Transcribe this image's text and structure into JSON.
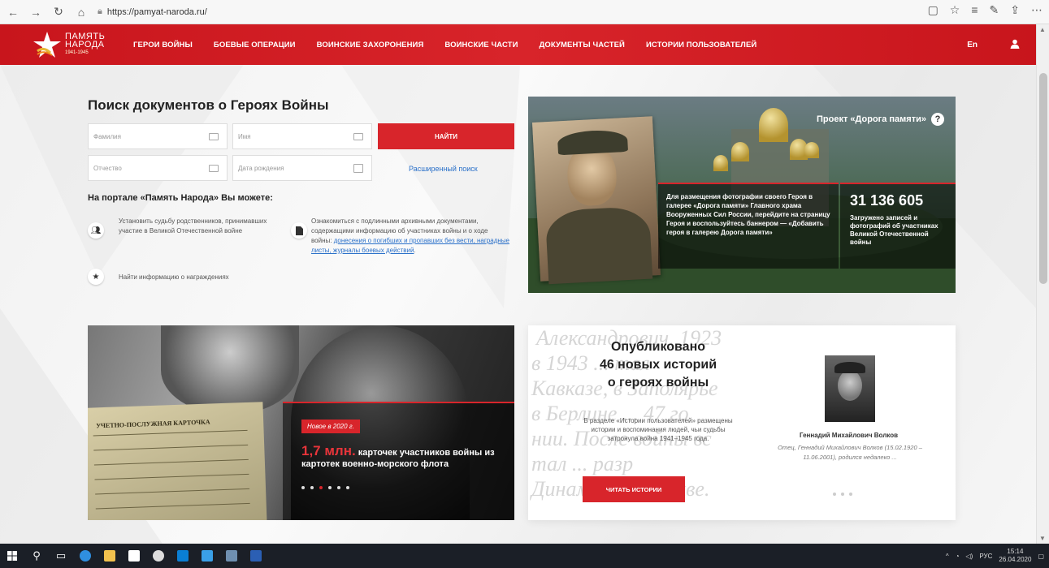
{
  "browser": {
    "url": "https://pamyat-naroda.ru/"
  },
  "header": {
    "logo_line1": "ПАМЯТЬ",
    "logo_line2": "НАРОДА",
    "logo_line3": "1941-1945",
    "menu": [
      "ГЕРОИ ВОЙНЫ",
      "БОЕВЫЕ ОПЕРАЦИИ",
      "ВОИНСКИЕ ЗАХОРОНЕНИЯ",
      "ВОИНСКИЕ ЧАСТИ",
      "ДОКУМЕНТЫ ЧАСТЕЙ",
      "ИСТОРИИ ПОЛЬЗОВАТЕЛЕЙ"
    ],
    "lang": "En"
  },
  "search": {
    "title": "Поиск документов о Героях Войны",
    "surname_placeholder": "Фамилия",
    "name_placeholder": "Имя",
    "patronymic_placeholder": "Отчество",
    "birthdate_placeholder": "Дата рождения",
    "submit_label": "НАЙТИ",
    "advanced_label": "Расширенный поиск"
  },
  "portal": {
    "title": "На портале «Память Народа» Вы можете:",
    "feature1": "Установить судьбу родственников, принимавших участие в Великой Отечественной войне",
    "feature2_text": "Ознакомиться с подлинными архивными документами, содержащими информацию об участниках войны и о ходе войны: ",
    "feature2_link": "донесения о погибших и пропавших без вести, наградные листы, журналы боевых действий",
    "feature2_end": ".",
    "feature3": "Найти информацию о награждениях"
  },
  "banner": {
    "project_title": "Проект «Дорога памяти»",
    "project_help": "?",
    "text": "Для размещения фотографии своего Героя в галерее «Дорога памяти» Главного храма Вооруженных Сил России, перейдите на страницу Героя и воспользуйтесь баннером — «Добавить героя в галерею Дорога памяти»",
    "count": "31 136 605",
    "count_caption": "Загружено записей и фотографий об участниках Великой Отечественной войны"
  },
  "photo_banner": {
    "badge": "Новое в 2020 г.",
    "highlight": "1,7 млн.",
    "text": " карточек участников войны из картотек военно-морского флота",
    "card_header": "УЧЕТНО-ПОСЛУЖНАЯ КАРТОЧКА",
    "slides": 6,
    "active_slide": 3
  },
  "stories": {
    "background_text": [
      "Александрович, 1923",
      "в 1943 ... тал",
      "Кавказе, в Заполярье",
      "в Берлине ... 47 го",
      "нии. После войны вс",
      "тал ... разр",
      "Динамо в г. Москве."
    ],
    "title_line1": "Опубликовано",
    "title_line2": "46 новых историй",
    "title_line3": "о героях войны",
    "description": "В разделе «Истории пользователей» размещены истории и воспоминания людей, чьи судьбы затронула война 1941–1945 года.",
    "button_label": "ЧИТАТЬ ИСТОРИИ",
    "hero_name": "Геннадий Михайлович Волков",
    "hero_quote": "Отец, Геннадий Михайлович Волков (15.02.1920 – 11.06.2001), родился недалеко ...",
    "dots": 3
  },
  "taskbar": {
    "lang": "РУС",
    "time": "15:14",
    "date": "26.04.2020"
  }
}
